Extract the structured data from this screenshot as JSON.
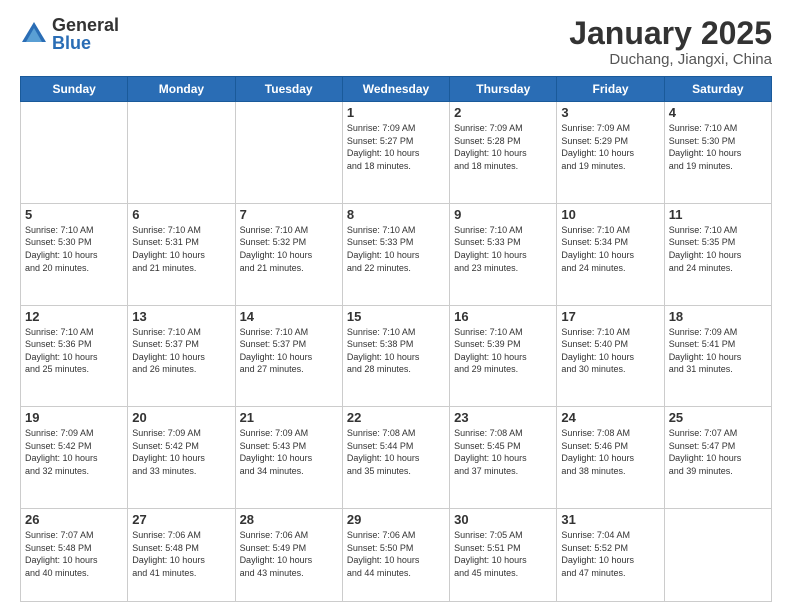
{
  "header": {
    "logo_general": "General",
    "logo_blue": "Blue",
    "month_title": "January 2025",
    "location": "Duchang, Jiangxi, China"
  },
  "weekdays": [
    "Sunday",
    "Monday",
    "Tuesday",
    "Wednesday",
    "Thursday",
    "Friday",
    "Saturday"
  ],
  "weeks": [
    [
      {
        "day": "",
        "info": ""
      },
      {
        "day": "",
        "info": ""
      },
      {
        "day": "",
        "info": ""
      },
      {
        "day": "1",
        "info": "Sunrise: 7:09 AM\nSunset: 5:27 PM\nDaylight: 10 hours\nand 18 minutes."
      },
      {
        "day": "2",
        "info": "Sunrise: 7:09 AM\nSunset: 5:28 PM\nDaylight: 10 hours\nand 18 minutes."
      },
      {
        "day": "3",
        "info": "Sunrise: 7:09 AM\nSunset: 5:29 PM\nDaylight: 10 hours\nand 19 minutes."
      },
      {
        "day": "4",
        "info": "Sunrise: 7:10 AM\nSunset: 5:30 PM\nDaylight: 10 hours\nand 19 minutes."
      }
    ],
    [
      {
        "day": "5",
        "info": "Sunrise: 7:10 AM\nSunset: 5:30 PM\nDaylight: 10 hours\nand 20 minutes."
      },
      {
        "day": "6",
        "info": "Sunrise: 7:10 AM\nSunset: 5:31 PM\nDaylight: 10 hours\nand 21 minutes."
      },
      {
        "day": "7",
        "info": "Sunrise: 7:10 AM\nSunset: 5:32 PM\nDaylight: 10 hours\nand 21 minutes."
      },
      {
        "day": "8",
        "info": "Sunrise: 7:10 AM\nSunset: 5:33 PM\nDaylight: 10 hours\nand 22 minutes."
      },
      {
        "day": "9",
        "info": "Sunrise: 7:10 AM\nSunset: 5:33 PM\nDaylight: 10 hours\nand 23 minutes."
      },
      {
        "day": "10",
        "info": "Sunrise: 7:10 AM\nSunset: 5:34 PM\nDaylight: 10 hours\nand 24 minutes."
      },
      {
        "day": "11",
        "info": "Sunrise: 7:10 AM\nSunset: 5:35 PM\nDaylight: 10 hours\nand 24 minutes."
      }
    ],
    [
      {
        "day": "12",
        "info": "Sunrise: 7:10 AM\nSunset: 5:36 PM\nDaylight: 10 hours\nand 25 minutes."
      },
      {
        "day": "13",
        "info": "Sunrise: 7:10 AM\nSunset: 5:37 PM\nDaylight: 10 hours\nand 26 minutes."
      },
      {
        "day": "14",
        "info": "Sunrise: 7:10 AM\nSunset: 5:37 PM\nDaylight: 10 hours\nand 27 minutes."
      },
      {
        "day": "15",
        "info": "Sunrise: 7:10 AM\nSunset: 5:38 PM\nDaylight: 10 hours\nand 28 minutes."
      },
      {
        "day": "16",
        "info": "Sunrise: 7:10 AM\nSunset: 5:39 PM\nDaylight: 10 hours\nand 29 minutes."
      },
      {
        "day": "17",
        "info": "Sunrise: 7:10 AM\nSunset: 5:40 PM\nDaylight: 10 hours\nand 30 minutes."
      },
      {
        "day": "18",
        "info": "Sunrise: 7:09 AM\nSunset: 5:41 PM\nDaylight: 10 hours\nand 31 minutes."
      }
    ],
    [
      {
        "day": "19",
        "info": "Sunrise: 7:09 AM\nSunset: 5:42 PM\nDaylight: 10 hours\nand 32 minutes."
      },
      {
        "day": "20",
        "info": "Sunrise: 7:09 AM\nSunset: 5:42 PM\nDaylight: 10 hours\nand 33 minutes."
      },
      {
        "day": "21",
        "info": "Sunrise: 7:09 AM\nSunset: 5:43 PM\nDaylight: 10 hours\nand 34 minutes."
      },
      {
        "day": "22",
        "info": "Sunrise: 7:08 AM\nSunset: 5:44 PM\nDaylight: 10 hours\nand 35 minutes."
      },
      {
        "day": "23",
        "info": "Sunrise: 7:08 AM\nSunset: 5:45 PM\nDaylight: 10 hours\nand 37 minutes."
      },
      {
        "day": "24",
        "info": "Sunrise: 7:08 AM\nSunset: 5:46 PM\nDaylight: 10 hours\nand 38 minutes."
      },
      {
        "day": "25",
        "info": "Sunrise: 7:07 AM\nSunset: 5:47 PM\nDaylight: 10 hours\nand 39 minutes."
      }
    ],
    [
      {
        "day": "26",
        "info": "Sunrise: 7:07 AM\nSunset: 5:48 PM\nDaylight: 10 hours\nand 40 minutes."
      },
      {
        "day": "27",
        "info": "Sunrise: 7:06 AM\nSunset: 5:48 PM\nDaylight: 10 hours\nand 41 minutes."
      },
      {
        "day": "28",
        "info": "Sunrise: 7:06 AM\nSunset: 5:49 PM\nDaylight: 10 hours\nand 43 minutes."
      },
      {
        "day": "29",
        "info": "Sunrise: 7:06 AM\nSunset: 5:50 PM\nDaylight: 10 hours\nand 44 minutes."
      },
      {
        "day": "30",
        "info": "Sunrise: 7:05 AM\nSunset: 5:51 PM\nDaylight: 10 hours\nand 45 minutes."
      },
      {
        "day": "31",
        "info": "Sunrise: 7:04 AM\nSunset: 5:52 PM\nDaylight: 10 hours\nand 47 minutes."
      },
      {
        "day": "",
        "info": ""
      }
    ]
  ]
}
